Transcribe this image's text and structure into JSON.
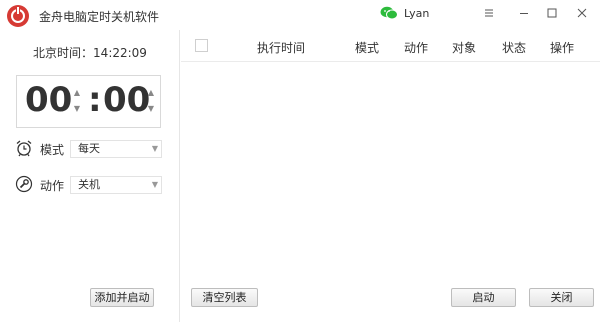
{
  "window": {
    "title": "金舟电脑定时关机软件",
    "user": "Lyan",
    "accent": "#d63a34"
  },
  "left": {
    "clock_label": "北京时间：14:22:09",
    "timer": {
      "hours": "00",
      "minutes": "00",
      "colon": ":"
    },
    "mode": {
      "label": "模式",
      "selected": "每天"
    },
    "action": {
      "label": "动作",
      "selected": "关机"
    },
    "add_start_label": "添加并启动"
  },
  "table": {
    "columns": [
      "执行时间",
      "模式",
      "动作",
      "对象",
      "状态",
      "操作"
    ],
    "rows": []
  },
  "footer": {
    "clear_label": "清空列表",
    "start_label": "启动",
    "close_label": "关闭"
  },
  "icons": {
    "app": "power-icon",
    "user": "wechat-icon",
    "mode": "alarm-clock-icon",
    "action": "wrench-icon"
  }
}
